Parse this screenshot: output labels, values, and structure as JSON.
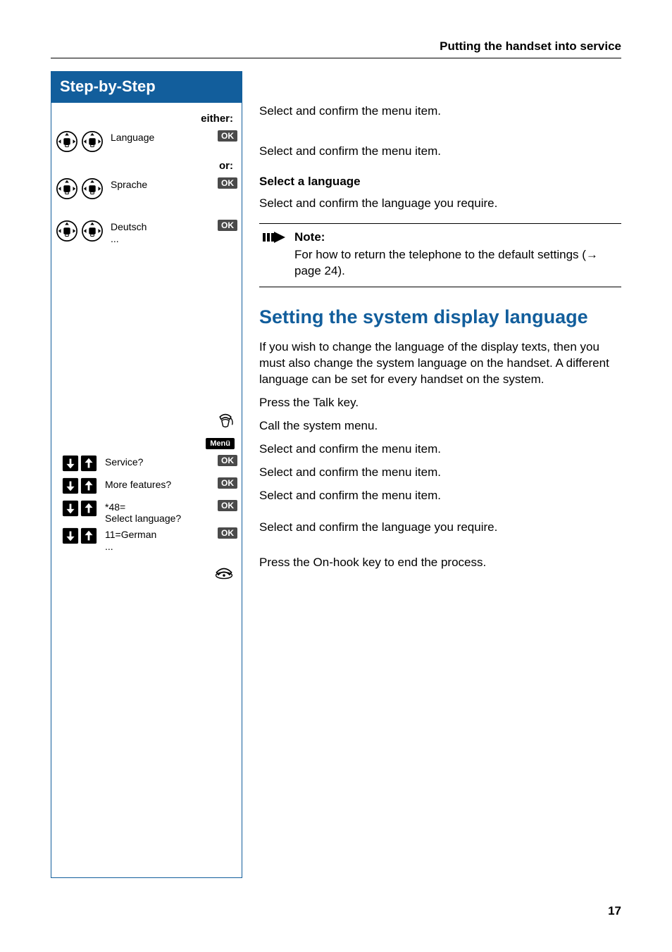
{
  "header": {
    "title": "Putting the handset into service"
  },
  "sidebar": {
    "title": "Step-by-Step",
    "either": "either:",
    "or": "or:",
    "row_language": {
      "label": "Language",
      "ok": "OK"
    },
    "row_sprache": {
      "label": "Sprache",
      "ok": "OK"
    },
    "row_deutsch": {
      "label": "Deutsch",
      "sub": "...",
      "ok": "OK"
    },
    "menu_badge": "Menü",
    "row_service": {
      "label": "Service?",
      "ok": "OK"
    },
    "row_more": {
      "label": "More features?",
      "ok": "OK"
    },
    "row_48": {
      "label1": "*48=",
      "label2": "Select language?",
      "ok": "OK"
    },
    "row_german": {
      "label": "11=German",
      "sub": "...",
      "ok": "OK"
    }
  },
  "main": {
    "inst1": "Select and confirm the menu item.",
    "inst2": "Select and confirm the menu item.",
    "select_lang_heading": "Select a language",
    "inst3": "Select and confirm the language you require.",
    "note": {
      "title": "Note:",
      "body_prefix": "For how to return the telephone to the default settings (",
      "arrow": "→",
      "body_suffix": " page 24)."
    },
    "h2": "Setting the system display language",
    "para": "If you wish to change the language of the display texts, then you must also change the system language on the handset. A different language can be set for every handset on the system.",
    "line_talk": "Press the Talk key.",
    "line_menu": "Call the system menu.",
    "line_service": "Select and confirm the menu item.",
    "line_more": "Select and confirm the menu item.",
    "line_48": "Select and confirm the menu item.",
    "line_german": "Select and confirm the language you require.",
    "line_onhook": "Press the On-hook key to end the process."
  },
  "page_number": "17"
}
